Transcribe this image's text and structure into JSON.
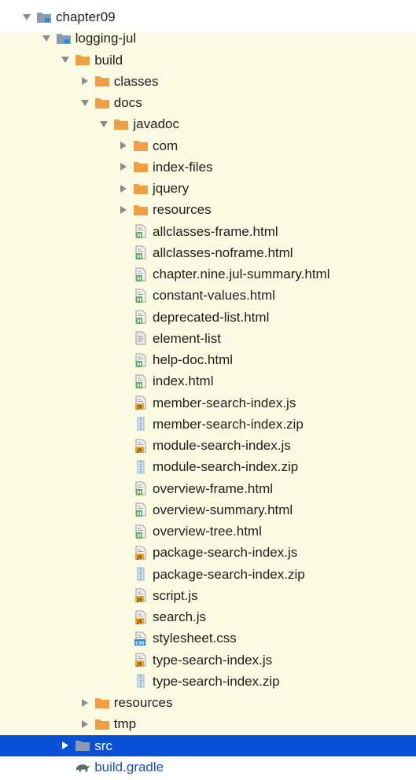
{
  "colors": {
    "highlight_background": "#fbfbe3",
    "selection_background": "#0a50d6",
    "folder": "#f0a042",
    "source_folder": "#8a9bb3"
  },
  "tree": [
    {
      "label": "chapter09",
      "icon": "module-folder-icon",
      "arrow": "expanded",
      "depth": 0
    },
    {
      "label": "logging-jul",
      "icon": "module-folder-icon",
      "arrow": "expanded",
      "depth": 1
    },
    {
      "label": "build",
      "icon": "folder-icon",
      "arrow": "expanded",
      "depth": 2
    },
    {
      "label": "classes",
      "icon": "folder-icon",
      "arrow": "collapsed",
      "depth": 3
    },
    {
      "label": "docs",
      "icon": "folder-icon",
      "arrow": "expanded",
      "depth": 3
    },
    {
      "label": "javadoc",
      "icon": "folder-icon",
      "arrow": "expanded",
      "depth": 4
    },
    {
      "label": "com",
      "icon": "folder-icon",
      "arrow": "collapsed",
      "depth": 5
    },
    {
      "label": "index-files",
      "icon": "folder-icon",
      "arrow": "collapsed",
      "depth": 5
    },
    {
      "label": "jquery",
      "icon": "folder-icon",
      "arrow": "collapsed",
      "depth": 5
    },
    {
      "label": "resources",
      "icon": "folder-icon",
      "arrow": "collapsed",
      "depth": 5
    },
    {
      "label": "allclasses-frame.html",
      "icon": "html-file-icon",
      "arrow": "none",
      "depth": 5
    },
    {
      "label": "allclasses-noframe.html",
      "icon": "html-file-icon",
      "arrow": "none",
      "depth": 5
    },
    {
      "label": "chapter.nine.jul-summary.html",
      "icon": "html-file-icon",
      "arrow": "none",
      "depth": 5
    },
    {
      "label": "constant-values.html",
      "icon": "html-file-icon",
      "arrow": "none",
      "depth": 5
    },
    {
      "label": "deprecated-list.html",
      "icon": "html-file-icon",
      "arrow": "none",
      "depth": 5
    },
    {
      "label": "element-list",
      "icon": "text-file-icon",
      "arrow": "none",
      "depth": 5
    },
    {
      "label": "help-doc.html",
      "icon": "html-file-icon",
      "arrow": "none",
      "depth": 5
    },
    {
      "label": "index.html",
      "icon": "html-file-icon",
      "arrow": "none",
      "depth": 5
    },
    {
      "label": "member-search-index.js",
      "icon": "js-file-icon",
      "arrow": "none",
      "depth": 5
    },
    {
      "label": "member-search-index.zip",
      "icon": "zip-file-icon",
      "arrow": "none",
      "depth": 5
    },
    {
      "label": "module-search-index.js",
      "icon": "js-file-icon",
      "arrow": "none",
      "depth": 5
    },
    {
      "label": "module-search-index.zip",
      "icon": "zip-file-icon",
      "arrow": "none",
      "depth": 5
    },
    {
      "label": "overview-frame.html",
      "icon": "html-file-icon",
      "arrow": "none",
      "depth": 5
    },
    {
      "label": "overview-summary.html",
      "icon": "html-file-icon",
      "arrow": "none",
      "depth": 5
    },
    {
      "label": "overview-tree.html",
      "icon": "html-file-icon",
      "arrow": "none",
      "depth": 5
    },
    {
      "label": "package-search-index.js",
      "icon": "js-file-icon",
      "arrow": "none",
      "depth": 5
    },
    {
      "label": "package-search-index.zip",
      "icon": "zip-file-icon",
      "arrow": "none",
      "depth": 5
    },
    {
      "label": "script.js",
      "icon": "js-file-icon",
      "arrow": "none",
      "depth": 5
    },
    {
      "label": "search.js",
      "icon": "js-file-icon",
      "arrow": "none",
      "depth": 5
    },
    {
      "label": "stylesheet.css",
      "icon": "css-file-icon",
      "arrow": "none",
      "depth": 5
    },
    {
      "label": "type-search-index.js",
      "icon": "js-file-icon",
      "arrow": "none",
      "depth": 5
    },
    {
      "label": "type-search-index.zip",
      "icon": "zip-file-icon",
      "arrow": "none",
      "depth": 5
    },
    {
      "label": "resources",
      "icon": "folder-icon",
      "arrow": "collapsed",
      "depth": 3
    },
    {
      "label": "tmp",
      "icon": "folder-icon",
      "arrow": "collapsed",
      "depth": 3
    },
    {
      "label": "src",
      "icon": "source-folder-icon",
      "arrow": "collapsed",
      "depth": 2,
      "selected": true
    },
    {
      "label": "build.gradle",
      "icon": "gradle-file-icon",
      "arrow": "none",
      "depth": 2,
      "link": true
    }
  ]
}
